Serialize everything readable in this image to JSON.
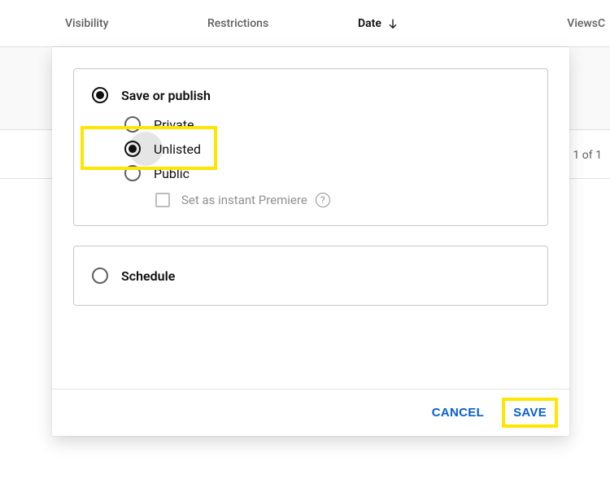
{
  "columns": {
    "visibility": "Visibility",
    "restrictions": "Restrictions",
    "date": "Date",
    "views": "Views",
    "last": "C"
  },
  "pagination": "1 of 1",
  "panel": {
    "save_or_publish": "Save or publish",
    "private": "Private",
    "unlisted": "Unlisted",
    "public": "Public",
    "premiere": "Set as instant Premiere",
    "schedule": "Schedule"
  },
  "footer": {
    "cancel": "CANCEL",
    "save": "SAVE"
  }
}
